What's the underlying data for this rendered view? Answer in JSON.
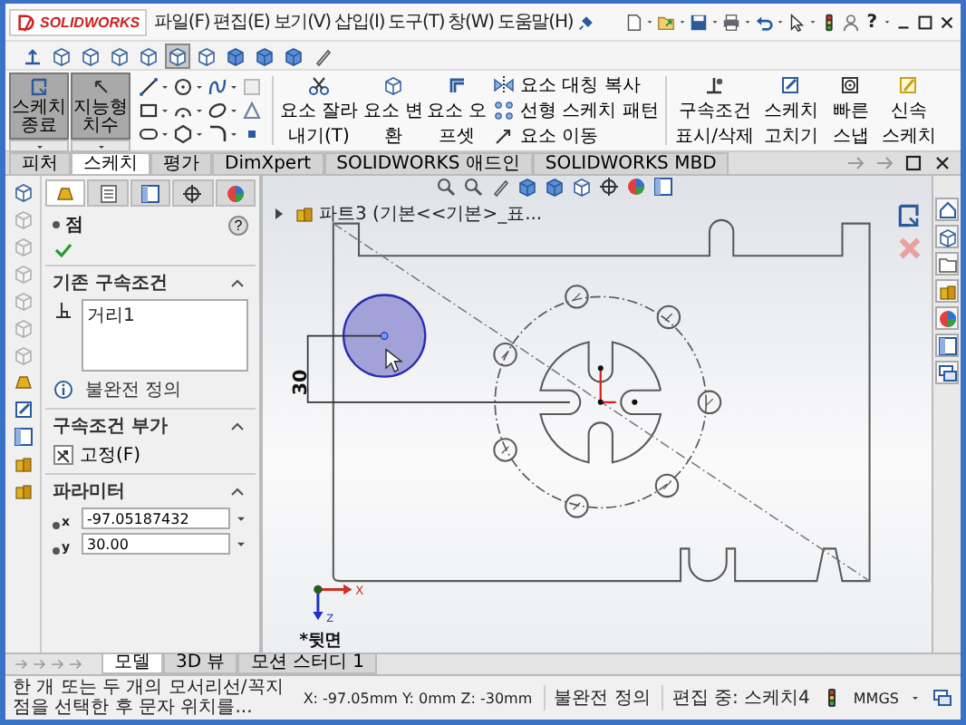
{
  "app": {
    "logo": "SOLIDWORKS"
  },
  "menu": [
    "파일(F)",
    "편집(E)",
    "보기(V)",
    "삽입(I)",
    "도구(T)",
    "창(W)",
    "도움말(H)"
  ],
  "help_label": "?",
  "view_buttons": [
    {
      "selected": false
    },
    {
      "selected": false
    },
    {
      "selected": false
    },
    {
      "selected": false
    },
    {
      "selected": false
    },
    {
      "selected": true
    },
    {
      "selected": false
    },
    {
      "selected": false
    },
    {
      "selected": false
    },
    {
      "selected": false
    },
    {
      "selected": false
    }
  ],
  "ribbon": {
    "main": [
      {
        "label": "스케치 종료",
        "pressed": true
      },
      {
        "label": "지능형 치수",
        "pressed": true
      }
    ],
    "tools": [
      "요소 잘라내기(T)",
      "요소 변환",
      "요소 오프셋"
    ],
    "list": [
      "요소 대칭 복사",
      "선형 스케치 패턴",
      "요소 이동"
    ],
    "more": [
      "구속조건 표시/삭제",
      "스케치 고치기",
      "빠른 스냅",
      "신속 스케치"
    ]
  },
  "panel_tabs": [
    {
      "selected": true
    },
    {
      "selected": false
    },
    {
      "selected": false
    },
    {
      "selected": false
    },
    {
      "selected": false
    }
  ],
  "tabs": [
    {
      "label": "피처",
      "selected": false
    },
    {
      "label": "스케치",
      "selected": true
    },
    {
      "label": "평가",
      "selected": false
    },
    {
      "label": "DimXpert",
      "selected": false
    },
    {
      "label": "SOLIDWORKS 애드인",
      "selected": false
    },
    {
      "label": "SOLIDWORKS MBD",
      "selected": false
    }
  ],
  "property_manager": {
    "title": "점",
    "help": "?",
    "existing_relations": {
      "title": "기존 구속조건",
      "items": [
        "거리1"
      ],
      "status": "불완전 정의"
    },
    "add_relations": {
      "title": "구속조건 부가",
      "items": [
        "고정(F)"
      ]
    },
    "parameters": {
      "title": "파라미터",
      "fields": [
        {
          "axis": "x",
          "value": "-97.05187432"
        },
        {
          "axis": "y",
          "value": "30.00"
        }
      ]
    }
  },
  "canvas": {
    "tree_label": "파트3 (기본<<기본>_표...",
    "dimension": "30",
    "triad": {
      "x": "X",
      "z": "Z"
    },
    "view_label": "*뒷면"
  },
  "bottom_tabs": [
    {
      "label": "모델",
      "selected": true
    },
    {
      "label": "3D 뷰",
      "selected": false
    },
    {
      "label": "모션 스터디 1",
      "selected": false
    }
  ],
  "status_bar": {
    "message": "한 개 또는 두 개의 모서리선/꼭지점을 선택한 후 문자 위치를...",
    "coordinates": "X: -97.05mm Y: 0mm Z: -30mm",
    "definition": "불완전 정의",
    "editing": "편집 중: 스케치4",
    "units": "MMGS"
  }
}
